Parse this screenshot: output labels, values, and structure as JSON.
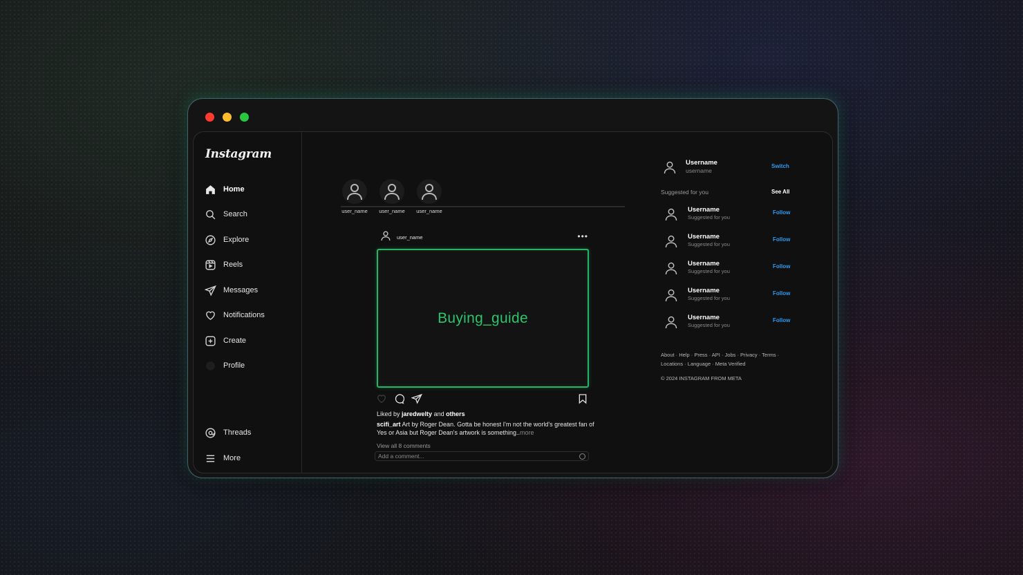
{
  "sidebar": {
    "logo": "Instagram",
    "items": [
      {
        "label": "Home",
        "icon": "home-icon"
      },
      {
        "label": "Search",
        "icon": "search-icon"
      },
      {
        "label": "Explore",
        "icon": "compass-icon"
      },
      {
        "label": "Reels",
        "icon": "reels-icon"
      },
      {
        "label": "Messages",
        "icon": "send-icon"
      },
      {
        "label": "Notifications",
        "icon": "heart-icon"
      },
      {
        "label": "Create",
        "icon": "plus-square-icon"
      },
      {
        "label": "Profile",
        "icon": "profile-avatar-icon"
      }
    ],
    "bottom_items": [
      {
        "label": "Threads",
        "icon": "threads-icon"
      },
      {
        "label": "More",
        "icon": "menu-icon"
      }
    ]
  },
  "stories": [
    {
      "name": "user_name"
    },
    {
      "name": "user_name"
    },
    {
      "name": "user_name"
    }
  ],
  "post": {
    "username": "user_name",
    "image_text": "Buying_guide",
    "liked_prefix": "Liked by ",
    "liked_user": "jaredwelty",
    "liked_and": " and ",
    "liked_others": "others",
    "caption_user": "scifi_art",
    "caption_text": " Art by Roger Dean. Gotta be honest I'm not the world's greatest fan of Yes or Asia but Roger Dean's artwork is something..",
    "caption_more": "more",
    "view_all": "View all 8 comments",
    "comment_placeholder": "Add a comment..."
  },
  "right": {
    "me": {
      "name": "Username",
      "handle": "username",
      "action": "Switch"
    },
    "suggested_header": "Suggested for you",
    "see_all": "See All",
    "suggestions": [
      {
        "name": "Username",
        "sub": "Suggested for you",
        "action": "Follow"
      },
      {
        "name": "Username",
        "sub": "Suggested for you",
        "action": "Follow"
      },
      {
        "name": "Username",
        "sub": "Suggested for you",
        "action": "Follow"
      },
      {
        "name": "Username",
        "sub": "Suggested for you",
        "action": "Follow"
      },
      {
        "name": "Username",
        "sub": "Suggested for you",
        "action": "Follow"
      }
    ],
    "footer_line1": "About · Help · Press · API · Jobs · Privacy · Terms ·",
    "footer_line2": "Locations · Language · Meta Verified",
    "copyright": "© 2024 INSTAGRAM FROM META"
  },
  "colors": {
    "accent_green": "#25b564",
    "link_blue": "#2e9bf0",
    "background": "#101010"
  }
}
